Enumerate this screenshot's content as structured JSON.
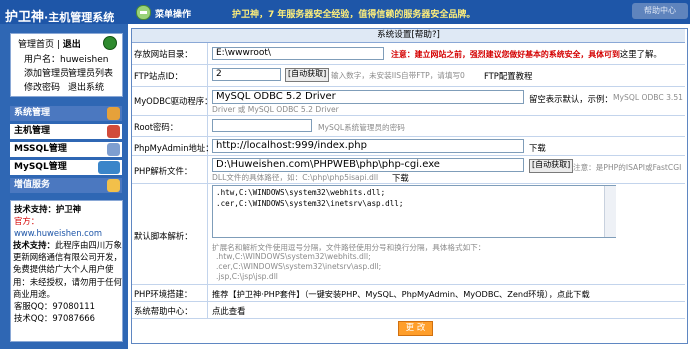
{
  "header": {
    "logo_big": "护卫神",
    "logo_rest": "·主机管理系统",
    "op_label": "菜单操作",
    "slogan": "护卫神，7 年服务器安全经验，值得信赖的服务器安全品牌。",
    "top_right": "帮助中心"
  },
  "sidebar": {
    "home_link": "管理首页",
    "logout_link": "退出",
    "username_label": "用户名：",
    "username": "huweishen",
    "add_admin": "添加管理员",
    "admin_list": "管理员列表",
    "change_pwd": "修改密码",
    "exit_system": "退出系统",
    "categories": [
      {
        "label": "系统管理",
        "active": true
      },
      {
        "label": "主机管理",
        "active": false
      },
      {
        "label": "MSSQL管理",
        "active": false
      },
      {
        "label": "MySQL管理",
        "active": false
      },
      {
        "label": "增值服务",
        "active": true
      }
    ],
    "support": {
      "title": "技术支持：",
      "title_value": "护卫神",
      "site_label": "官方：",
      "site": "www.huweishen.com",
      "desc_label": "技术支持：",
      "desc": "此程序由四川万象更新网络通信有限公司开发，免费提供给广大个人用户使用：未经授权，请勿用于任何商业用途。",
      "qq1_label": "客服QQ：",
      "qq1": "97080111",
      "qq2_label": "技术QQ：",
      "qq2": "97087666"
    }
  },
  "form": {
    "title": "系统设置[帮助?]",
    "site_dir_label": "存放网站目录：",
    "site_dir_value": "E:\\wwwroot\\",
    "site_dir_note_red": "注意：建立网站之前，强烈建议您做好基本的系统安全，具体可到",
    "site_dir_note_link": "这里了解。",
    "ftp_port_label": "FTP站点ID：",
    "ftp_port_value": "2",
    "ftp_auto_btn": "[自动获取]",
    "ftp_hint": "输入数字，未安装IIS自带FTP，请填写0",
    "ftp_tutorial": "FTP配置教程",
    "odbc_label": "MyODBC驱动程序：",
    "odbc_value": "MySQL ODBC 5.2 Driver",
    "odbc_note": "留空表示默认，示例：",
    "odbc_example_1": "MySQL ODBC 3.51",
    "odbc_example_2": "Driver 或 MySQL ODBC 5.2 Driver",
    "root_pwd_label": "Root密码：",
    "root_pwd_value": "",
    "root_pwd_hint": "MySQL系统管理员的密码",
    "phpmyadmin_label": "PhpMyAdmin地址：",
    "phpmyadmin_value": "http://localhost:999/index.php",
    "phpmyadmin_download": "下载",
    "php_parser_label": "PHP解析文件：",
    "php_parser_value": "D:\\Huweishen.com\\PHPWEB\\php\\php-cgi.exe",
    "php_auto_btn": "[自动获取]",
    "php_note": "注意：是PHP的ISAPI或FastCGI",
    "php_note_2": "DLL文件的具体路径，如：C:\\php\\php5isapi.dll",
    "php_download": "下载",
    "default_script_label": "默认脚本解析：",
    "default_script_value": ".htw,C:\\WINDOWS\\system32\\webhits.dll;\n.cer,C:\\WINDOWS\\system32\\inetsrv\\asp.dll;",
    "default_script_hint_1": "扩展名和解析文件使用逗号分隔，文件路径使用分号和换行分隔，具体格式如下：",
    "default_script_hint_2": ".htw,C:\\WINDOWS\\system32\\webhits.dll;",
    "default_script_hint_3": ".cer,C:\\WINDOWS\\system32\\inetsrv\\asp.dll;",
    "default_script_hint_4": ".jsp,C:\\jsp\\jsp.dll",
    "php_env_label": "PHP环境搭建：",
    "php_env_text": "推荐【护卫神·PHP套件】（一键安装PHP、MySQL、PhpMyAdmin、MyODBC、Zend环境），点此下载",
    "help_label": "系统帮助中心：",
    "help_link": "点此查看",
    "save_button": "更 改"
  }
}
